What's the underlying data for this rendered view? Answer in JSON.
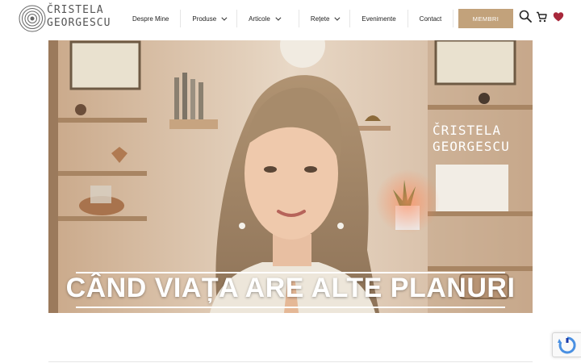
{
  "logo": {
    "line1": "ČRISTELA",
    "line2": "GEORGESCU",
    "icon": "spiral-icon"
  },
  "nav": {
    "items": [
      {
        "label": "Despre Mine",
        "dropdown": false
      },
      {
        "label": "Produse",
        "dropdown": true
      },
      {
        "label": "Articole",
        "dropdown": true
      },
      {
        "label": "Rețete",
        "dropdown": true
      },
      {
        "label": "Evenimente",
        "dropdown": false
      },
      {
        "label": "Contact",
        "dropdown": false
      }
    ],
    "cta_label": "MEMBRI"
  },
  "icons": {
    "search": "search-icon",
    "cart": "cart-icon",
    "heart": "heart-icon"
  },
  "hero": {
    "title": "CÂND VIAȚA ARE ALTE PLANURI",
    "watermark_line1": "ČRISTELA",
    "watermark_line2": "GEORGESCU"
  },
  "colors": {
    "accent": "#c2a27b",
    "heart": "#a8283b"
  }
}
